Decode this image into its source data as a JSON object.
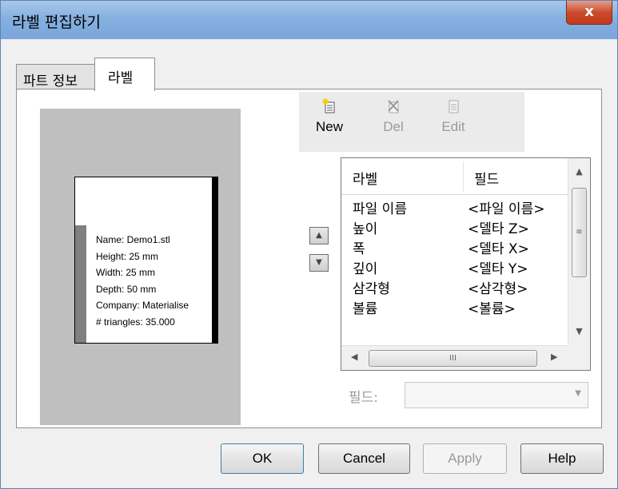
{
  "window": {
    "title": "라벨 편집하기",
    "close_label": "x"
  },
  "tabs": [
    {
      "label": "파트 정보"
    },
    {
      "label": "라벨"
    }
  ],
  "preview": {
    "lines": [
      "Name: Demo1.stl",
      "Height: 25 mm",
      "Width: 25 mm",
      "Depth: 50 mm",
      "Company: Materialise",
      "# triangles: 35.000"
    ]
  },
  "toolbar": {
    "new": {
      "label": "New",
      "icon": "new-label-icon"
    },
    "del": {
      "label": "Del",
      "icon": "delete-label-icon"
    },
    "edit": {
      "label": "Edit",
      "icon": "edit-label-icon"
    }
  },
  "list": {
    "headers": [
      "라벨",
      "필드"
    ],
    "rows": [
      {
        "label": "파일 이름",
        "field": "<파일 이름>"
      },
      {
        "label": "높이",
        "field": "<델타 Z>"
      },
      {
        "label": "폭",
        "field": "<델타 X>"
      },
      {
        "label": "깊이",
        "field": "<델타 Y>"
      },
      {
        "label": "삼각형",
        "field": "<삼각형>"
      },
      {
        "label": "볼륨",
        "field": "<볼륨>"
      }
    ]
  },
  "field_selector": {
    "label": "필드:",
    "value": ""
  },
  "buttons": {
    "ok": "OK",
    "cancel": "Cancel",
    "apply": "Apply",
    "help": "Help"
  },
  "colors": {
    "titlebar": "#86b0e0",
    "close": "#cc4a2c",
    "preview_bg": "#bfbfbf"
  }
}
